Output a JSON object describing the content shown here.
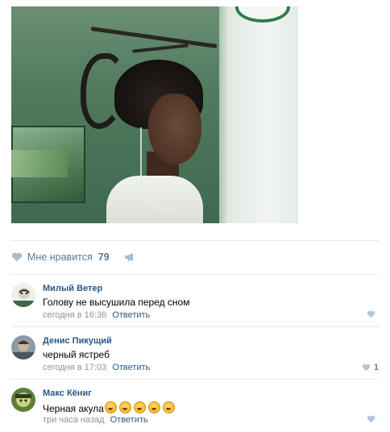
{
  "post": {
    "likes_label": "Мне нравится",
    "likes_count": "79"
  },
  "comments": [
    {
      "author": "Милый Ветер",
      "text": "Голову не высушила перед сном",
      "time": "сегодня в 16:36",
      "reply": "Ответить",
      "likes": ""
    },
    {
      "author": "Денис Пикущий",
      "text": "черный ястреб",
      "time": "сегодня в 17:03",
      "reply": "Ответить",
      "likes": "1"
    },
    {
      "author": "Макс Кёниг",
      "text": "Черная акула",
      "time": "три часа назад",
      "reply": "Ответить",
      "likes": ""
    }
  ],
  "icons": {
    "like": "heart-icon",
    "share": "megaphone-icon",
    "emoji": "laughing-emoji"
  },
  "colors": {
    "link": "#2a5885",
    "like_text": "#5f7896",
    "meta": "#939393",
    "divider": "#e7e8ec"
  }
}
